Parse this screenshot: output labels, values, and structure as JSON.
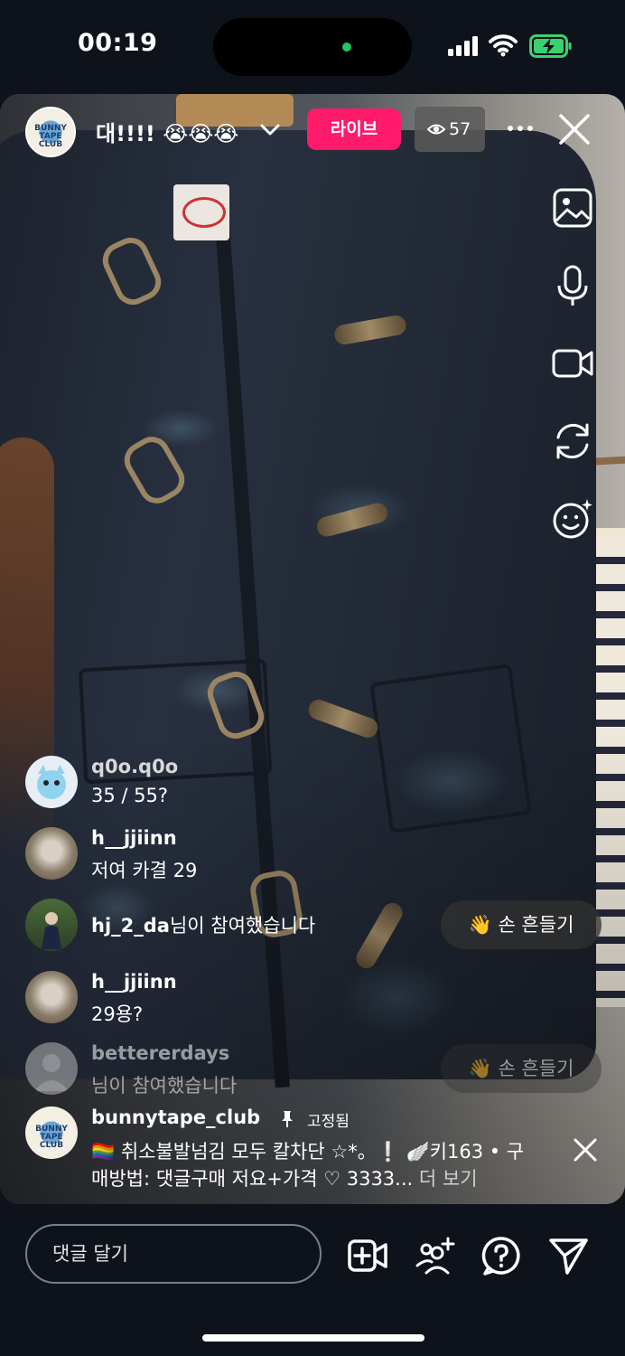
{
  "status_bar": {
    "time": "00:19"
  },
  "host": {
    "title": "대!!!! 😭😭😭",
    "avatar_text": "BUNNY TAPE CLUB"
  },
  "live_badge": "라이브",
  "viewer_count": "57",
  "comments": [
    {
      "username": "q0o.q0o",
      "text": "35 / 55?"
    },
    {
      "username": "h__jjiinn",
      "text": "저여 카결 29"
    },
    {
      "username": "hj_2_da",
      "joined_suffix": "님이 참여했습니다",
      "wave_label": "손 흔들기"
    },
    {
      "username": "h__jjiinn",
      "text": "29용?"
    },
    {
      "username": "bettererdays",
      "joined_suffix": "님이 참여했습니다",
      "wave_label": "손 흔들기"
    }
  ],
  "wave_emoji": "👋",
  "pinned": {
    "username": "bunnytape_club",
    "label": "고정됨",
    "line1": "🏳️‍🌈 취소불발넘김 모두 칼차단 ☆*。❕ 🪽키163 • 구",
    "line2": "매방법: 댓글구매 저요+가격 ♡ 3333...",
    "more": "더 보기"
  },
  "comment_input": {
    "placeholder": "댓글 달기"
  },
  "icons": {
    "top": [
      "chevron-down-icon",
      "eye-icon",
      "more-icon",
      "close-icon"
    ],
    "side": [
      "gallery-icon",
      "microphone-icon",
      "video-camera-icon",
      "camera-flip-icon",
      "face-effects-icon"
    ],
    "bottom": [
      "add-video-icon",
      "add-guest-icon",
      "question-icon",
      "send-icon"
    ]
  }
}
